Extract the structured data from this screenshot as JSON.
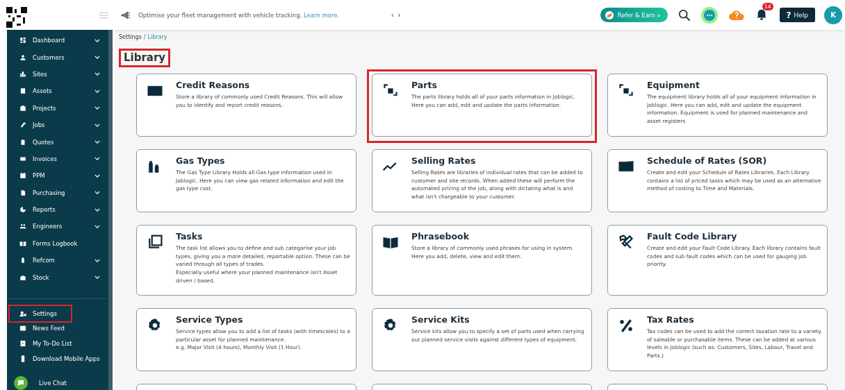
{
  "topbar": {
    "announcement": "Optimise your fleet management with vehicle tracking.",
    "announcement_link": "Learn more.",
    "prev": "‹",
    "next": "›",
    "refer_button": "Refer & Earn",
    "refer_chevron": "»",
    "notification_count": "14",
    "help_button": "Help",
    "help_glyph": "?",
    "avatar": "K"
  },
  "sidebar": {
    "items": [
      {
        "label": "Dashboard",
        "expandable": true
      },
      {
        "label": "Customers",
        "expandable": true
      },
      {
        "label": "Sites",
        "expandable": true
      },
      {
        "label": "Assets",
        "expandable": true
      },
      {
        "label": "Projects",
        "expandable": true
      },
      {
        "label": "Jobs",
        "expandable": true
      },
      {
        "label": "Quotes",
        "expandable": true
      },
      {
        "label": "Invoices",
        "expandable": true
      },
      {
        "label": "PPM",
        "expandable": true
      },
      {
        "label": "Purchasing",
        "expandable": true
      },
      {
        "label": "Reports",
        "expandable": true
      },
      {
        "label": "Engineers",
        "expandable": true
      },
      {
        "label": "Forms Logbook",
        "expandable": false
      },
      {
        "label": "Refcom",
        "expandable": true
      },
      {
        "label": "Stock",
        "expandable": true
      }
    ],
    "bottom_items": [
      {
        "label": "Settings",
        "highlighted": true
      },
      {
        "label": "News Feed",
        "highlighted": false
      },
      {
        "label": "My To-Do List",
        "highlighted": false
      },
      {
        "label": "Download Mobile Apps",
        "highlighted": false
      }
    ],
    "live_chat": "Live Chat"
  },
  "breadcrumb": {
    "parent": "Settings",
    "separator": "/",
    "current": "Library"
  },
  "page_title": {
    "text": "Library",
    "highlighted": true
  },
  "cards": [
    {
      "title": "Credit Reasons",
      "highlighted": false,
      "description": "Store a library of commonly used Credit Reasons. This will allow you to identify and report credit reasons."
    },
    {
      "title": "Parts",
      "highlighted": true,
      "description": "The parts library holds all of your parts information in Joblogic. Here you can add, edit and update the parts information."
    },
    {
      "title": "Equipment",
      "highlighted": false,
      "description": "The equipment library holds all of your equipment information in Joblogic. Here you can add, edit and update the equipment information. Equipment is used for planned maintenance and asset registers"
    },
    {
      "title": "Gas Types",
      "highlighted": false,
      "description": "The Gas Type Library Holds all Gas type information used in Joblogic. Here you can view gas related information and edit the gas type cost."
    },
    {
      "title": "Selling Rates",
      "highlighted": false,
      "description": "Selling Rates are libraries of individual rates that can be added to customer and site records. When added these will perform the automated pricing of the job, along with dictating what is and what isn't chargeable to your customer."
    },
    {
      "title": "Schedule of Rates (SOR)",
      "highlighted": false,
      "description": "Create and edit your Schedule of Rates Libraries. Each Library contains a list of priced tasks which may be used as an alternative method of costing to Time and Materials."
    },
    {
      "title": "Tasks",
      "highlighted": false,
      "description": "The task list allows you to define and sub categorise your job types, giving you a more detailed, reportable option. These can be varied through all types of trades.\nEspecially useful where your planned maintenance isn't Asset driven / based."
    },
    {
      "title": "Phrasebook",
      "highlighted": false,
      "description": "Store a library of commonly used phrases for using in system. Here you add, delete, view and edit them."
    },
    {
      "title": "Fault Code Library",
      "highlighted": false,
      "description": "Create and edit your Fault Code Library. Each library contains fault codes and sub fault codes which can be used for gauging job priority."
    },
    {
      "title": "Service Types",
      "highlighted": false,
      "description": "Service types allow you to add a list of tasks (with timescales) to a particular asset for planned maintenance.\ne.g. Major Visit (4 hours), Monthly Visit (1 Hour)."
    },
    {
      "title": "Service Kits",
      "highlighted": false,
      "description": "Service kits allow you to specify a set of parts used when carrying out planned service visits against different types of equipment."
    },
    {
      "title": "Tax Rates",
      "highlighted": false,
      "description": "Tax codes can be used to add the correct taxation rate to a variety of saleable or purchasable items. These can be added at various levels in Joblogic (such as: Customers, Sites, Labour, Travel and Parts.)"
    }
  ]
}
